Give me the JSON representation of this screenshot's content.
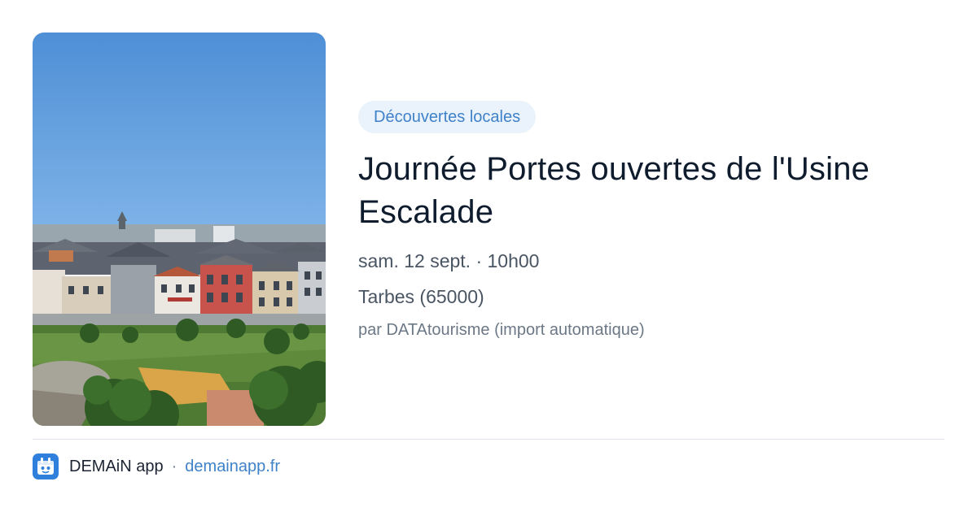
{
  "event": {
    "category": "Découvertes locales",
    "title": "Journée Portes ouvertes de l'Usine Escalade",
    "date_time": "sam. 12 sept. · 10h00",
    "location": "Tarbes (65000)",
    "source": "par DATAtourisme (import automatique)",
    "image": "city-rooftops-photo"
  },
  "footer": {
    "logo_icon": "demain-app-logo-icon",
    "app_name": "DEMAiN app",
    "separator": "·",
    "site": "demainapp.fr"
  },
  "colors": {
    "accent": "#3f82c9",
    "badge_bg": "#eaf2fb",
    "title": "#0f1c2e",
    "muted": "#4a5563"
  }
}
